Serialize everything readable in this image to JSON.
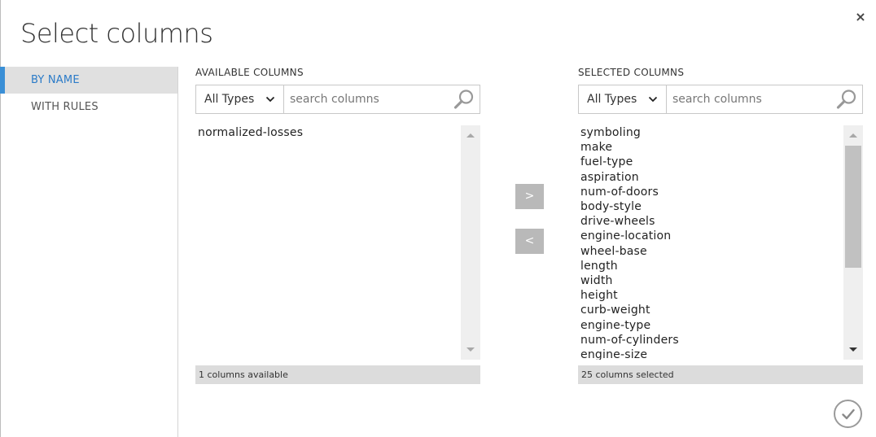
{
  "dialog": {
    "title": "Select columns",
    "close_label": "×"
  },
  "tabs": [
    {
      "label": "BY NAME",
      "active": true
    },
    {
      "label": "WITH RULES",
      "active": false
    }
  ],
  "available": {
    "header": "AVAILABLE COLUMNS",
    "type_filter": "All Types",
    "search_placeholder": "search columns",
    "items": [
      "normalized-losses"
    ],
    "status": "1 columns available"
  },
  "selected": {
    "header": "SELECTED COLUMNS",
    "type_filter": "All Types",
    "search_placeholder": "search columns",
    "items": [
      "symboling",
      "make",
      "fuel-type",
      "aspiration",
      "num-of-doors",
      "body-style",
      "drive-wheels",
      "engine-location",
      "wheel-base",
      "length",
      "width",
      "height",
      "curb-weight",
      "engine-type",
      "num-of-cylinders",
      "engine-size"
    ],
    "status": "25 columns selected"
  },
  "actions": {
    "add_label": ">",
    "remove_label": "<"
  },
  "icons": {
    "search": "search-icon",
    "chevron": "chevron-down-icon",
    "ok": "checkmark-icon",
    "close": "close-icon"
  },
  "colors": {
    "accent": "#3a8fd6",
    "active_tab_text": "#2b7bc8",
    "button_gray": "#b9b9b9"
  }
}
